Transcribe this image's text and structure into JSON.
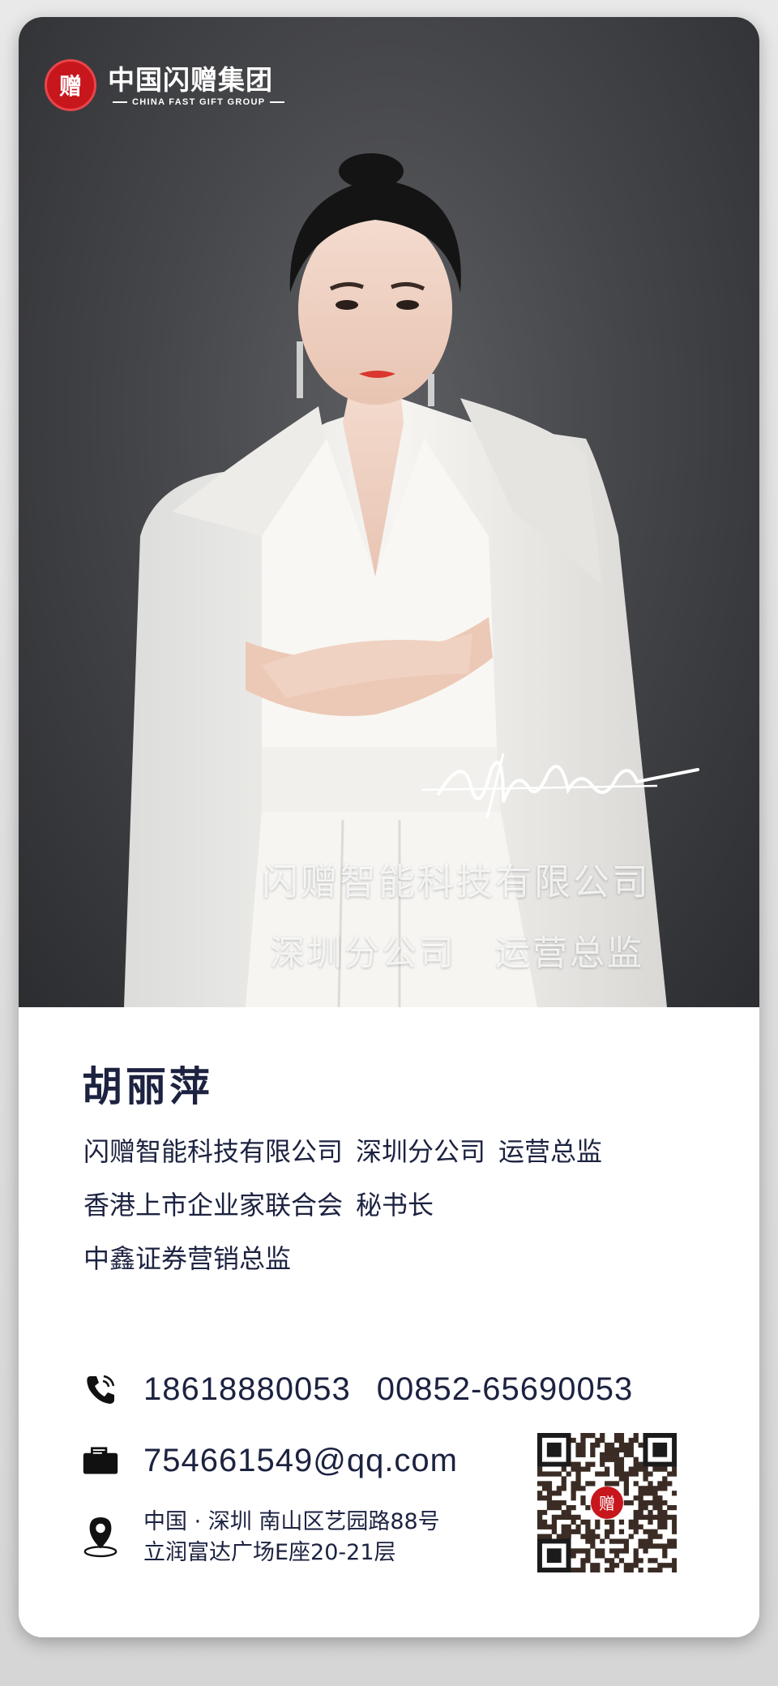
{
  "brand": {
    "logo_glyph": "赠",
    "name_cn": "中国闪赠集团",
    "name_en": "CHINA FAST GIFT GROUP",
    "color": "#c8161d"
  },
  "photo_overlay": {
    "company": "闪赠智能科技有限公司",
    "branch": "深圳分公司",
    "role": "运营总监"
  },
  "profile": {
    "name": "胡丽萍",
    "titles": [
      [
        "闪赠智能科技有限公司",
        "深圳分公司",
        "运营总监"
      ],
      [
        "香港上市企业家联合会",
        "秘书长"
      ],
      [
        "中鑫证券营销总监"
      ]
    ]
  },
  "contact": {
    "mobile": "18618880053",
    "hk_phone": "00852-65690053",
    "email": "754661549@qq.com",
    "address_line1": "中国 · 深圳  南山区艺园路88号",
    "address_line2": "立润富达广场E座20-21层",
    "icons": [
      "phone-icon",
      "mail-icon",
      "location-pin-icon"
    ]
  },
  "colors": {
    "text_dark": "#1c2240",
    "photo_bg": "#45464a"
  }
}
